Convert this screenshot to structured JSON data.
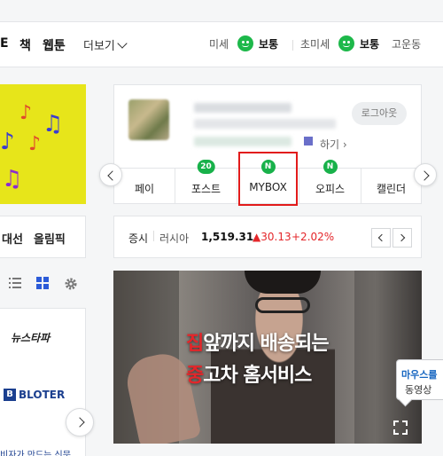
{
  "nav": {
    "links": [
      "E",
      "책",
      "웹툰"
    ],
    "more_label": "더보기"
  },
  "air": {
    "fine_dust_label": "미세",
    "fine_dust_status": "보통",
    "ultra_fine_label": "초미세",
    "ultra_fine_status": "보통",
    "location": "고운동",
    "status_color": "#1db84a"
  },
  "left": {
    "tab1": "대선",
    "tab2": "올림픽",
    "press_logo_1": "뉴스타파",
    "press_logo_2": "BLOTER",
    "bottom_text": "비자가 만드는 신문"
  },
  "login": {
    "logout_label": "로그아웃",
    "settings_link": "하기",
    "services": [
      {
        "label": "페이",
        "badge": ""
      },
      {
        "label": "포스트",
        "badge": "20"
      },
      {
        "label": "MYBOX",
        "badge": "N"
      },
      {
        "label": "오피스",
        "badge": "N"
      },
      {
        "label": "캘린더",
        "badge": ""
      }
    ],
    "badge_color": "#18b14a",
    "highlight_color": "#e21b1b"
  },
  "stock": {
    "category": "증시",
    "market": "러시아",
    "value": "1,519.31",
    "change": "▲30.13",
    "change_pct": "+2.02%",
    "up_color": "#e4262a"
  },
  "ad": {
    "line1_red": "집",
    "line1_rest": "앞까지 배송되는",
    "line2_red": "중",
    "line2_rest": "고차 홈서비스"
  },
  "tooltip": {
    "title": "마우스를",
    "body": "동영상"
  }
}
